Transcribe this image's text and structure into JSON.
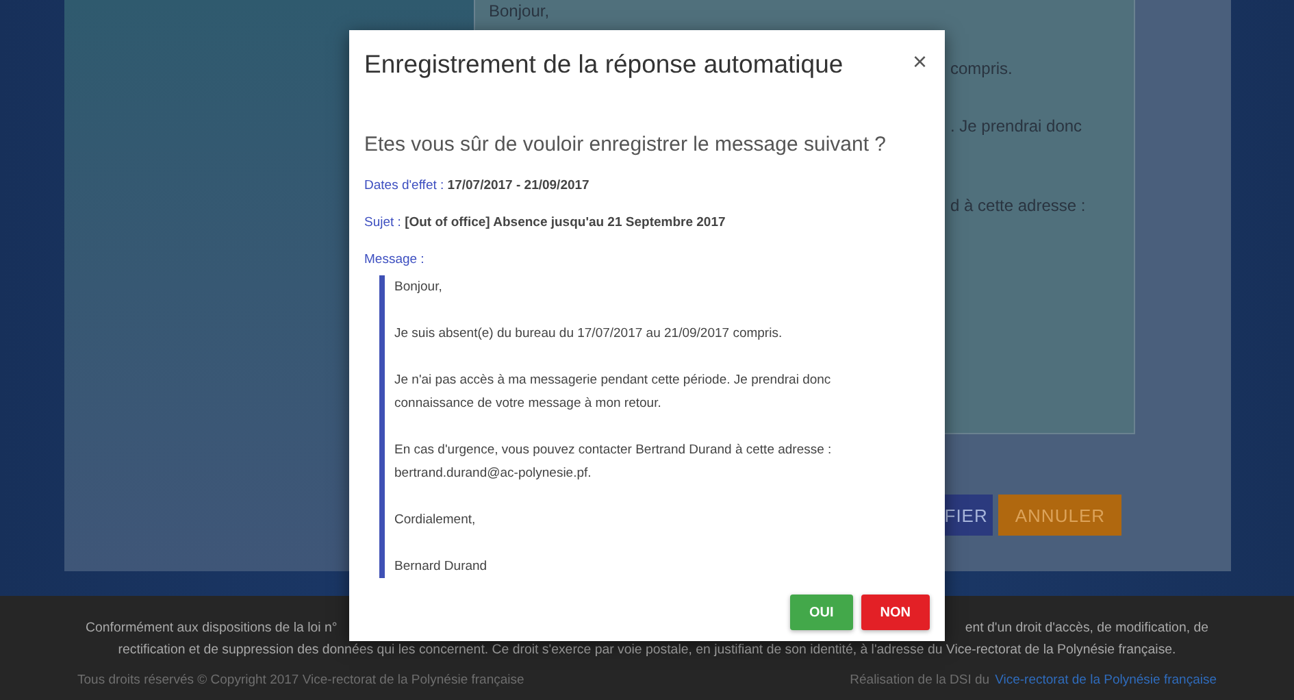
{
  "background_page": {
    "message_lines": [
      "Bonjour,",
      "compris.",
      ". Je prendrai donc",
      "d à cette adresse :"
    ],
    "buttons": [
      "FIER",
      "ANNULER"
    ]
  },
  "dialog": {
    "title": "Enregistrement de la réponse automatique",
    "close": "×",
    "question": "Etes vous sûr de vouloir enregistrer le message suivant ?",
    "fields": [
      {
        "label": "Dates d'effet :",
        "value": "17/07/2017 - 21/09/2017"
      },
      {
        "label": "Sujet :",
        "value": "[Out of office] Absence jusqu'au 21 Septembre 2017"
      }
    ],
    "message_label": "Message :",
    "message_paragraphs": [
      [
        "Bonjour,"
      ],
      [
        "Je suis absent(e) du bureau du 17/07/2017 au 21/09/2017 compris."
      ],
      [
        "Je n'ai pas accès à ma messagerie pendant cette période. Je prendrai donc",
        "connaissance de votre message à mon retour."
      ],
      [
        "En cas d'urgence, vous pouvez contacter Bertrand Durand à cette adresse :",
        "bertrand.durand@ac-polynesie.pf."
      ],
      [
        "Cordialement,"
      ],
      [
        "Bernard Durand"
      ]
    ],
    "buttons": [
      {
        "label": "OUI",
        "kind": "confirm"
      },
      {
        "label": "NON",
        "kind": "cancel"
      }
    ]
  },
  "footer": {
    "notice_line_1": [
      "Conformément aux dispositions de la loi n°",
      "ent d'un droit d'accès, de modification, de"
    ],
    "notice_line_2": "rectification et de suppression des données qui les concernent. Ce droit s'exerce par voie postale, en justifiant de son identité, à l'adresse du Vice-rectorat de la Polynésie française.",
    "copyright": "Tous droits réservés © Copyright 2017 Vice-rectorat de la Polynésie française",
    "credit": "Réalisation de la DSI du",
    "credit_link": "Vice-rectorat de la Polynésie française"
  }
}
